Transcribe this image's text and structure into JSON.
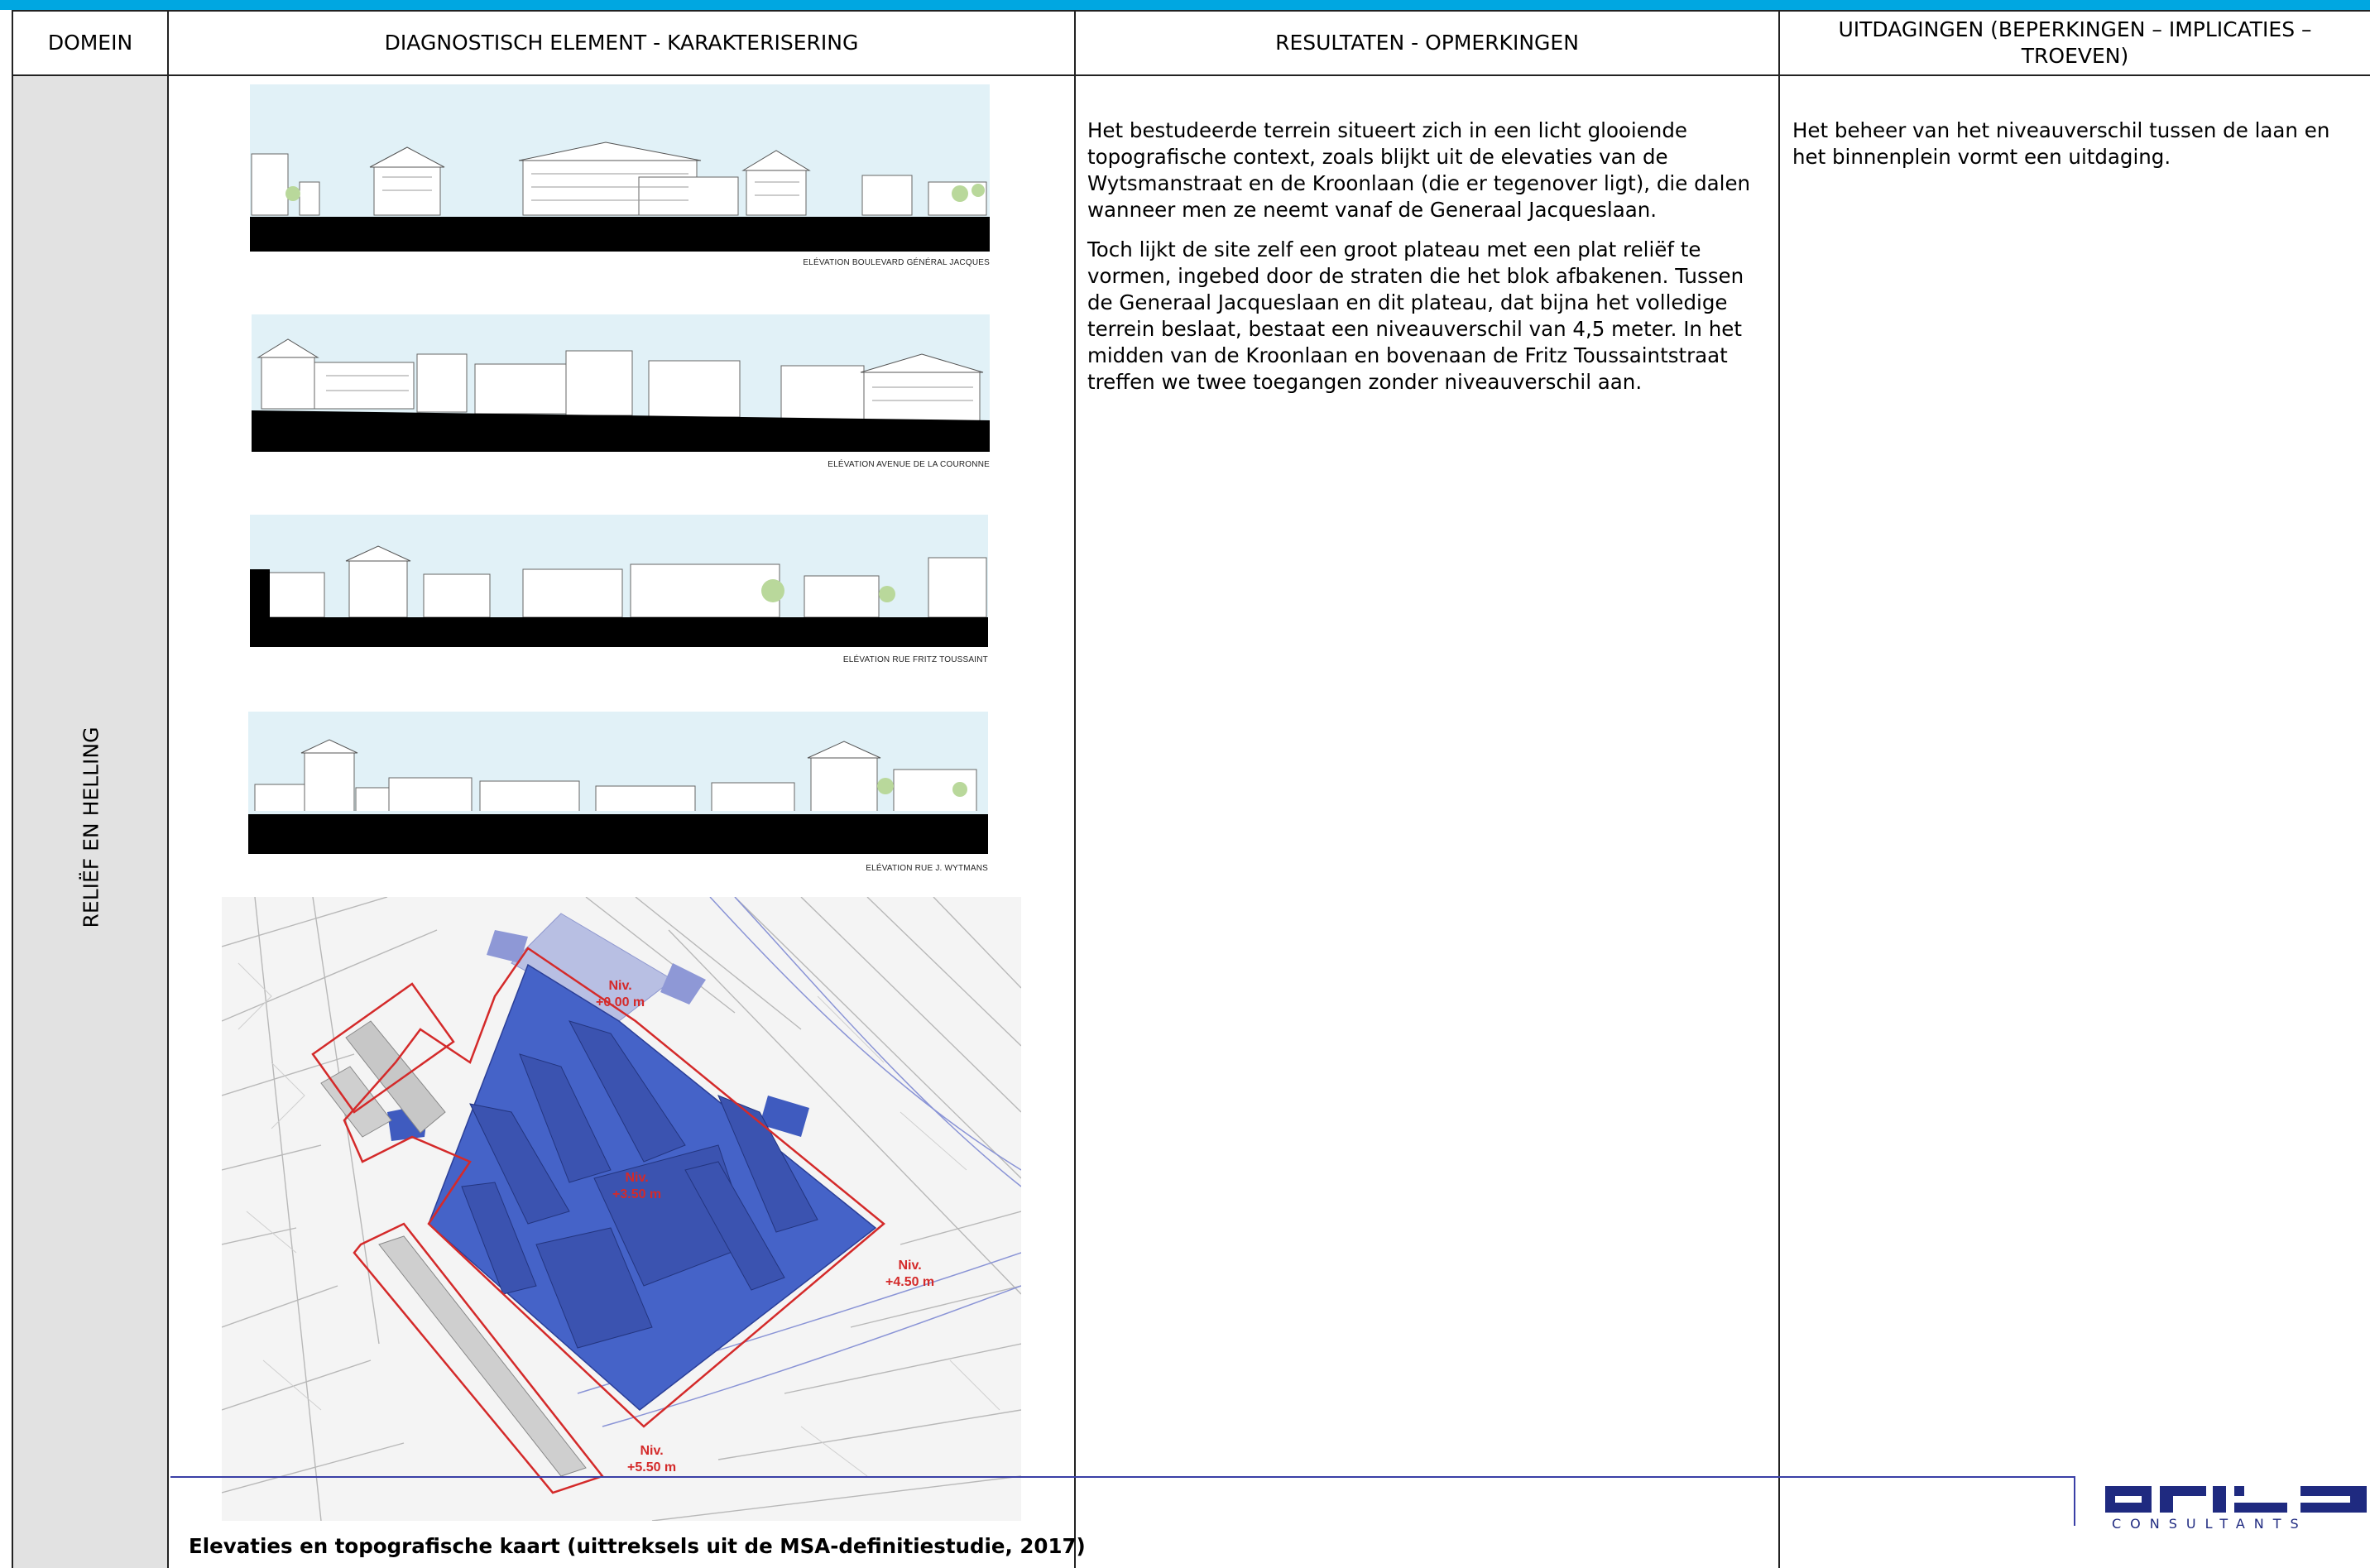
{
  "header": {
    "col_domain": "DOMEIN",
    "col_diagnostic": "DIAGNOSTISCH ELEMENT - KARAKTERISERING",
    "col_results": "RESULTATEN - OPMERKINGEN",
    "col_challenges": "UITDAGINGEN (BEPERKINGEN – IMPLICATIES – TROEVEN)"
  },
  "row": {
    "domain": "RELIËF EN HELLING",
    "results": [
      "Het bestudeerde terrein situeert zich in een licht glooiende topografische context, zoals blijkt uit de elevaties van de Wytsmanstraat en de Kroonlaan (die er tegenover ligt), die dalen wanneer men ze neemt vanaf de Generaal Jacqueslaan.",
      "Toch lijkt de site zelf een groot plateau met een plat reliëf te vormen, ingebed door de straten die het blok afbakenen. Tussen de Generaal Jacqueslaan en dit plateau, dat bijna het volledige terrein beslaat, bestaat een niveauverschil van 4,5 meter. In het midden van de Kroonlaan en bovenaan de Fritz Toussaintstraat treffen we twee toegangen zonder niveauverschil aan."
    ],
    "challenges": "Het beheer van het niveauverschil tussen de laan en het binnenplein vormt een uitdaging."
  },
  "elevations": [
    {
      "caption": "ELÉVATION BOULEVARD GÉNÉRAL JACQUES"
    },
    {
      "caption": "ELÉVATION AVENUE DE LA COURONNE"
    },
    {
      "caption": "ELÉVATION RUE FRITZ TOUSSAINT"
    },
    {
      "caption": "ELÉVATION RUE J. WYTMANS"
    }
  ],
  "map": {
    "level_labels": [
      {
        "line1": "Niv.",
        "line2": "+0.00 m"
      },
      {
        "line1": "Niv.",
        "line2": "+3.50 m"
      },
      {
        "line1": "Niv.",
        "line2": "+4.50 m"
      },
      {
        "line1": "Niv.",
        "line2": "+5.50 m"
      }
    ],
    "colors": {
      "plateau": "#3f5bbf",
      "boundary": "#d42a2a",
      "label": "#d42a2a"
    }
  },
  "figure_caption": "Elevaties en topografische kaart (uittreksels uit de MSA-definitiestudie, 2017)",
  "logo": {
    "sub": "CONSULTANTS"
  },
  "colors": {
    "topbar": "#00a7e1",
    "domain_bg": "#e2e2e2",
    "footer_line": "#3a3fa6",
    "logo": "#1f2a80"
  }
}
